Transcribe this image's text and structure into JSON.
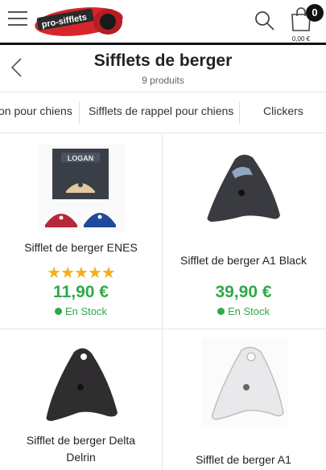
{
  "header": {
    "logo_text": "pro-sifflets",
    "cart_count": "0",
    "cart_total": "0,00 €"
  },
  "title_bar": {
    "title": "Sifflets de berger",
    "subtitle": "9 produits"
  },
  "categories": [
    {
      "label": "on pour chiens"
    },
    {
      "label": "Sifflets de rappel pour chiens"
    },
    {
      "label": "Clickers"
    }
  ],
  "products": [
    {
      "name": "Sifflet de berger ENES",
      "rating": "★★★★★",
      "price": "11,90 €",
      "stock": "En Stock",
      "image_text": "LOGAN"
    },
    {
      "name": "Sifflet de berger A1 Black",
      "price": "39,90 €",
      "stock": "En Stock"
    },
    {
      "name": "Sifflet de berger Delta Delrin"
    },
    {
      "name": "Sifflet de berger A1"
    }
  ],
  "colors": {
    "price": "#2eaa4a",
    "stars": "#f2b01e",
    "logo_red": "#d7262b"
  }
}
